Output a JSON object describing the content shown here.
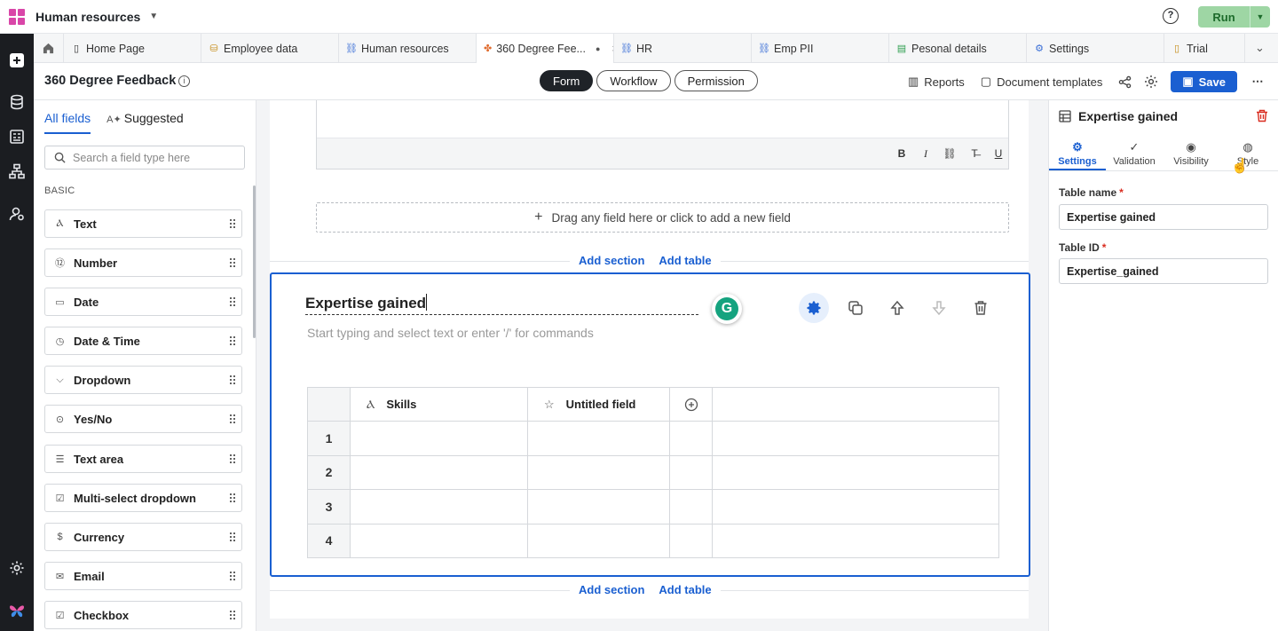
{
  "app": {
    "title": "Human resources",
    "run_label": "Run",
    "help": "?"
  },
  "tabs": [
    {
      "label": "Home Page",
      "icon": "page-icon"
    },
    {
      "label": "Employee data",
      "icon": "database-icon"
    },
    {
      "label": "Human resources",
      "icon": "link-icon"
    },
    {
      "label": "360 Degree Fee...",
      "icon": "form-icon",
      "active": true,
      "dirty": true
    },
    {
      "label": "HR",
      "icon": "link-icon"
    },
    {
      "label": "Emp PII",
      "icon": "link-icon"
    },
    {
      "label": "Pesonal details",
      "icon": "doc-icon"
    },
    {
      "label": "Settings",
      "icon": "gear-icon"
    },
    {
      "label": "Trial",
      "icon": "page-icon"
    }
  ],
  "subheader": {
    "title": "360 Degree Feedback",
    "modes": [
      "Form",
      "Workflow",
      "Permission"
    ],
    "active_mode": "Form",
    "reports": "Reports",
    "doc_templates": "Document templates",
    "save": "Save"
  },
  "palette": {
    "tab_all": "All fields",
    "tab_suggested": "Suggested",
    "search_placeholder": "Search a field type here",
    "section": "BASIC",
    "items": [
      {
        "label": "Text",
        "icon": "text-icon"
      },
      {
        "label": "Number",
        "icon": "number-icon"
      },
      {
        "label": "Date",
        "icon": "calendar-icon"
      },
      {
        "label": "Date & Time",
        "icon": "datetime-icon"
      },
      {
        "label": "Dropdown",
        "icon": "dropdown-icon"
      },
      {
        "label": "Yes/No",
        "icon": "toggle-icon"
      },
      {
        "label": "Text area",
        "icon": "textarea-icon"
      },
      {
        "label": "Multi-select dropdown",
        "icon": "multiselect-icon"
      },
      {
        "label": "Currency",
        "icon": "currency-icon"
      },
      {
        "label": "Email",
        "icon": "email-icon"
      },
      {
        "label": "Checkbox",
        "icon": "checkbox-icon"
      }
    ]
  },
  "canvas": {
    "drop_hint": "Drag any field here or click to add a new field",
    "add_section": "Add section",
    "add_table": "Add table",
    "section": {
      "title": "Expertise gained",
      "description_placeholder": "Start typing and select text or enter '/' for commands",
      "columns": [
        "Skills",
        "Untitled field"
      ],
      "rows": [
        "1",
        "2",
        "3",
        "4"
      ]
    }
  },
  "right_panel": {
    "title": "Expertise gained",
    "tabs": [
      "Settings",
      "Validation",
      "Visibility",
      "Style"
    ],
    "active_tab": "Settings",
    "table_name_label": "Table name",
    "table_name_value": "Expertise gained",
    "table_id_label": "Table ID",
    "table_id_value": "Expertise_gained"
  },
  "colors": {
    "accent": "#1a5fd1",
    "run_bg": "#9ed6a4",
    "danger": "#d92d20",
    "rail": "#1b1d21"
  }
}
